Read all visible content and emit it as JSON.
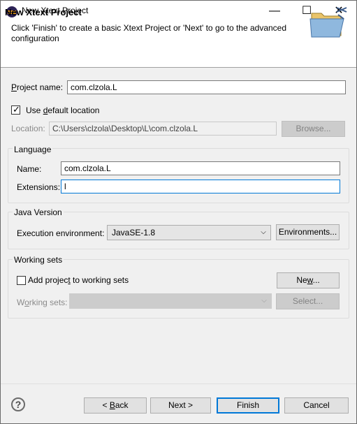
{
  "window": {
    "title": "New Xtext Project",
    "minimize_glyph": "—",
    "maximize_glyph": "☐",
    "close_glyph": "✕"
  },
  "header": {
    "title": "New Xtext Project",
    "description": "Click 'Finish' to create a basic Xtext Project or 'Next' to go to the advanced configuration"
  },
  "project": {
    "name_label_mn": "P",
    "name_label_rest": "roject name:",
    "name_value": "com.clzola.L",
    "use_default_pre": "Use ",
    "use_default_mn": "d",
    "use_default_post": "efault location",
    "use_default_checked": true,
    "location_label": "Location:",
    "location_value": "C:\\Users\\clzola\\Desktop\\L\\com.clzola.L",
    "browse_label": "Browse..."
  },
  "language": {
    "group_title": "Language",
    "name_label": "Name:",
    "name_value": "com.clzola.L",
    "extensions_label": "Extensions:",
    "extensions_value": "l"
  },
  "java": {
    "group_title": "Java Version",
    "exec_env_label": "Execution environment:",
    "exec_env_value": "JavaSE-1.8",
    "environments_label": "Environments..."
  },
  "working_sets": {
    "group_title": "Working sets",
    "add_label_pre": "Add projec",
    "add_label_mn": "t",
    "add_label_post": " to working sets",
    "add_checked": false,
    "new_label_pre": "Ne",
    "new_label_mn": "w",
    "new_label_post": "...",
    "ws_label_pre": "W",
    "ws_label_mn": "o",
    "ws_label_post": "rking sets:",
    "select_label": "Select..."
  },
  "footer": {
    "help_glyph": "?",
    "back_label_pre": "< ",
    "back_label_mn": "B",
    "back_label_post": "ack",
    "next_label": "Next >",
    "finish_label": "Finish",
    "cancel_label": "Cancel"
  },
  "colors": {
    "accent": "#0078d7",
    "background": "#f0f0f0"
  }
}
